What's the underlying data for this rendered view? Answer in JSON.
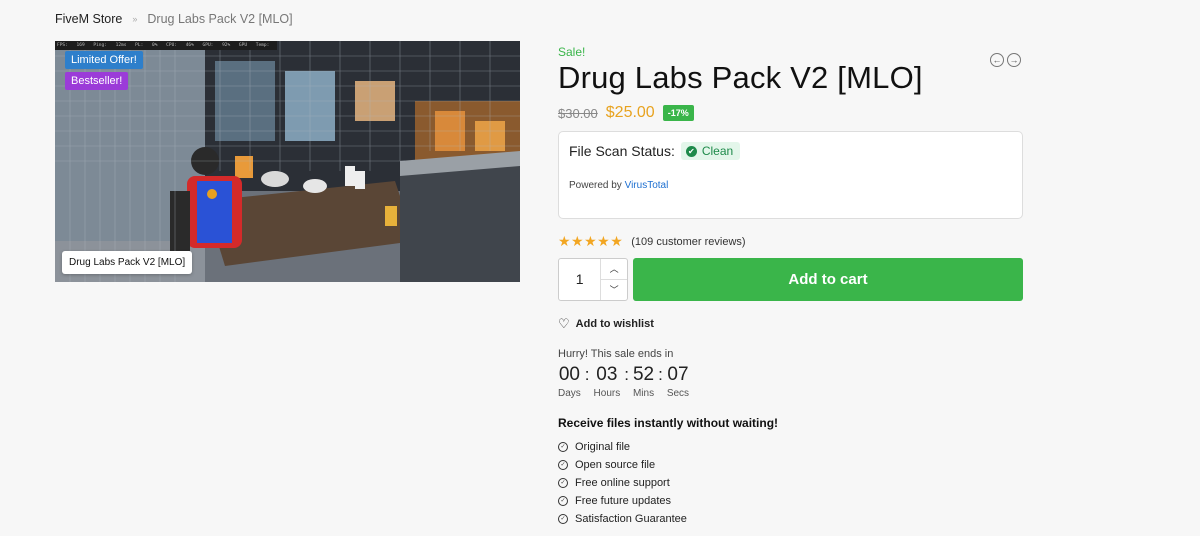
{
  "breadcrumb": {
    "home": "FiveM Store",
    "separator": "»",
    "current": "Drug Labs Pack V2 [MLO]"
  },
  "gallery": {
    "hud": "FPS: 169 Ping: 12ms PL: 0% CPU: 46% GPU: 92% GPU Temp: 78°C",
    "badge_limited": "Limited Offer!",
    "badge_bestseller": "Bestseller!",
    "caption": "Drug Labs Pack V2 [MLO]",
    "badge_limited_color": "#2e7fcb",
    "badge_bestseller_color": "#9b3bd8"
  },
  "product": {
    "sale_label": "Sale!",
    "title": "Drug Labs Pack V2 [MLO]",
    "old_price": "$30.00",
    "new_price": "$25.00",
    "discount": "-17%",
    "nav_prev_icon": "←",
    "nav_next_icon": "→"
  },
  "scan": {
    "label": "File Scan Status:",
    "status": "Clean",
    "status_icon": "✔",
    "powered_prefix": "Powered by ",
    "powered_link": "VirusTotal"
  },
  "rating": {
    "stars": "★★★★★",
    "value": 5,
    "reviews": "(109 customer reviews)"
  },
  "cart": {
    "quantity": "1",
    "step_up": "︿",
    "step_down": "﹀",
    "button": "Add to cart",
    "accent": "#3ab54a"
  },
  "wishlist": {
    "icon": "♡",
    "label": "Add to wishlist"
  },
  "countdown": {
    "hurry": "Hurry! This sale ends in",
    "sep": ":",
    "days": "00",
    "days_label": "Days",
    "hours": "03",
    "hours_label": "Hours",
    "mins": "52",
    "mins_label": "Mins",
    "secs": "07",
    "secs_label": "Secs"
  },
  "features": {
    "title": "Receive files instantly without waiting!",
    "check_icon": "✓",
    "items": [
      "Original file",
      "Open source file",
      "Free online support",
      "Free future updates",
      "Satisfaction Guarantee"
    ]
  }
}
